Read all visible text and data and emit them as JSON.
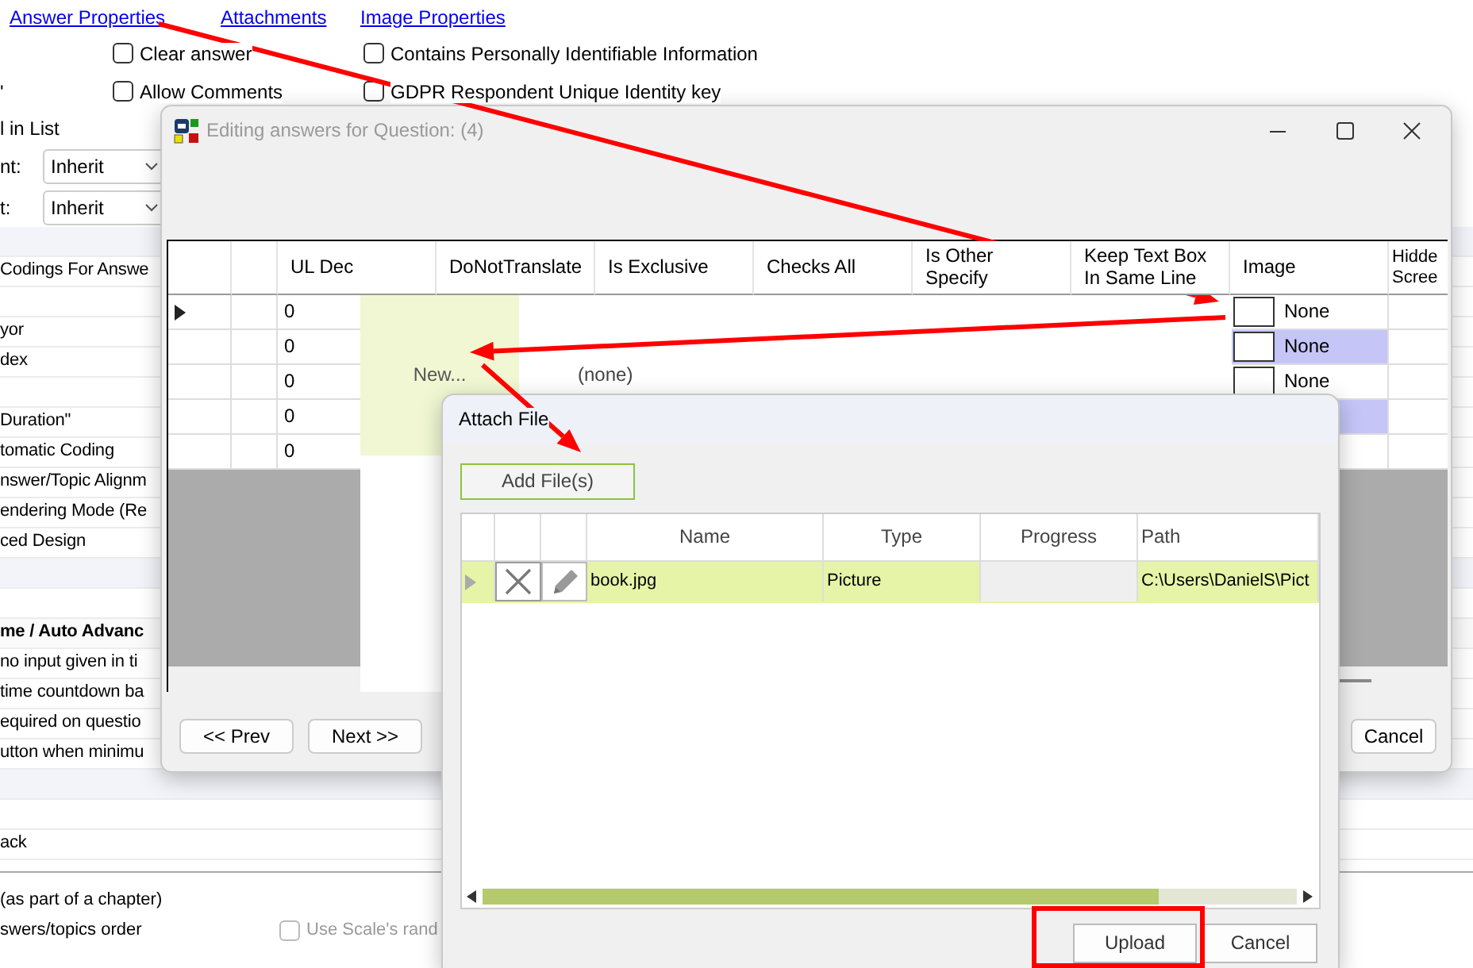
{
  "background": {
    "links": [
      {
        "label": "Answer Properties"
      },
      {
        "label": "Attachments"
      },
      {
        "label": "Image Properties"
      }
    ],
    "checkbox_rows": [
      {
        "side_label": "",
        "boxes": [
          {
            "label": "Clear answer",
            "checked": false
          },
          {
            "label": "Contains Personally Identifiable Information",
            "checked": false
          }
        ]
      },
      {
        "side_label": "'",
        "boxes": [
          {
            "label": "Allow Comments",
            "checked": false
          },
          {
            "label": "GDPR Respondent Unique Identity key",
            "checked": false
          }
        ]
      }
    ],
    "list_label": "l in List",
    "selects": [
      {
        "label": "nt:",
        "value": "Inherit"
      },
      {
        "label": "t:",
        "value": "Inherit"
      }
    ],
    "property_rows": [
      {
        "kind": "band"
      },
      {
        "kind": "text",
        "label": "Codings For Answe"
      },
      {
        "kind": "blank"
      },
      {
        "kind": "text",
        "label": "yor"
      },
      {
        "kind": "text",
        "label": "dex"
      },
      {
        "kind": "blank"
      },
      {
        "kind": "text",
        "label": "Duration\""
      },
      {
        "kind": "text",
        "label": "tomatic Coding"
      },
      {
        "kind": "text",
        "label": "nswer/Topic Alignm"
      },
      {
        "kind": "text",
        "label": "endering Mode (Re"
      },
      {
        "kind": "text",
        "label": "ced Design"
      },
      {
        "kind": "band"
      },
      {
        "kind": "blank"
      },
      {
        "kind": "header",
        "label": "me / Auto Advanc"
      },
      {
        "kind": "text",
        "label": "no input given in ti"
      },
      {
        "kind": "text",
        "label": "time countdown ba"
      },
      {
        "kind": "text",
        "label": "equired on questio"
      },
      {
        "kind": "text",
        "label": "utton when minimu"
      },
      {
        "kind": "band"
      },
      {
        "kind": "blank"
      },
      {
        "kind": "text",
        "label": "ack"
      }
    ],
    "lower_rows": [
      {
        "label": "(as part of a chapter)"
      },
      {
        "label": "swers/topics order",
        "checkbox": {
          "label": "Use Scale's rand",
          "checked": false,
          "disabled": true
        }
      }
    ]
  },
  "editing_window": {
    "title": "Editing answers for Question: (4)",
    "columns": [
      "UL Dec",
      "DoNotTranslate",
      "Is Exclusive",
      "Checks All",
      "Is Other Specify",
      "Keep Text Box In Same Line",
      "Image",
      "Hidde Scree"
    ],
    "rows": [
      {
        "current": true,
        "ul_dec": "0",
        "image": "None",
        "selected": false
      },
      {
        "current": false,
        "ul_dec": "0",
        "image": "None",
        "selected": true
      },
      {
        "current": false,
        "ul_dec": "0",
        "image": "None",
        "selected": false
      },
      {
        "current": false,
        "ul_dec": "0",
        "selected": true
      },
      {
        "current": false,
        "ul_dec": "0",
        "selected": false
      }
    ],
    "dropdown": {
      "items": [
        {
          "label": "New...",
          "selected": true
        },
        {
          "label": "(none)",
          "selected": false
        }
      ]
    },
    "buttons": {
      "prev": "<< Prev",
      "next": "Next >>",
      "cancel": "Cancel"
    }
  },
  "attach_dialog": {
    "title": "Attach File",
    "add_button": "Add File(s)",
    "columns": [
      "Name",
      "Type",
      "Progress",
      "Path"
    ],
    "rows": [
      {
        "name": "book.jpg",
        "type": "Picture",
        "path": "C:\\Users\\DanielS\\Pict",
        "selected": true
      }
    ],
    "buttons": {
      "upload": "Upload",
      "cancel": "Cancel"
    }
  }
}
